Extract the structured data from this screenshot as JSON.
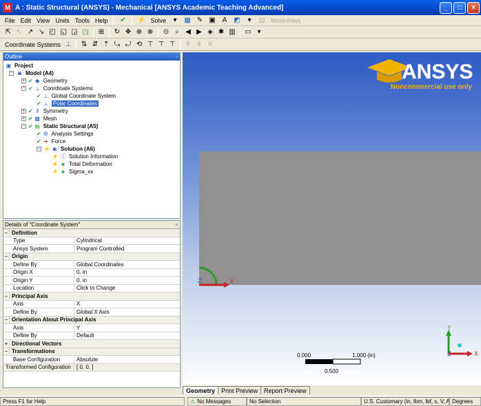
{
  "window": {
    "title": "A : Static Structural (ANSYS) - Mechanical [ANSYS Academic Teaching Advanced]",
    "app_icon": "ansys-mechanical-icon"
  },
  "menu": [
    "File",
    "Edit",
    "View",
    "Units",
    "Tools",
    "Help"
  ],
  "toolbar": {
    "solve_label": "Solve",
    "worksheet_label": "Worksheet"
  },
  "context_toolbar": {
    "label": "Coordinate Systems"
  },
  "outline": {
    "title": "Outline",
    "nodes": [
      {
        "label": "Project",
        "bold": true
      },
      {
        "label": "Model (A4)",
        "bold": true
      },
      {
        "label": "Geometry"
      },
      {
        "label": "Coordinate Systems"
      },
      {
        "label": "Global Coordinate System"
      },
      {
        "label": "Polar Coordinates"
      },
      {
        "label": "Symmetry"
      },
      {
        "label": "Mesh"
      },
      {
        "label": "Static Structural (A5)",
        "bold": true
      },
      {
        "label": "Analysis Settings"
      },
      {
        "label": "Force"
      },
      {
        "label": "Solution (A6)",
        "bold": true
      },
      {
        "label": "Solution Information"
      },
      {
        "label": "Total Deformation"
      },
      {
        "label": "Sigma_xx"
      }
    ]
  },
  "details": {
    "title": "Details of \"Coordinate System\"",
    "groups": [
      {
        "name": "Definition",
        "rows": [
          [
            "Type",
            "Cylindrical"
          ],
          [
            "Ansys System",
            "Program Controlled"
          ]
        ]
      },
      {
        "name": "Origin",
        "rows": [
          [
            "Define By",
            "Global Coordinates"
          ],
          [
            "Origin X",
            "0. in"
          ],
          [
            "Origin Y",
            "0. in"
          ],
          [
            "Location",
            "Click to Change"
          ]
        ]
      },
      {
        "name": "Principal Axis",
        "rows": [
          [
            "Axis",
            "X"
          ],
          [
            "Define By",
            "Global X Axis"
          ]
        ]
      },
      {
        "name": "Orientation About Principal Axis",
        "rows": [
          [
            "Axis",
            "Y"
          ],
          [
            "Define By",
            "Default"
          ]
        ]
      },
      {
        "name": "Directional Vectors",
        "rows": []
      },
      {
        "name": "Transformations",
        "rows": [
          [
            "Base Configuration",
            "Absolute"
          ],
          [
            "Transformed Configuration",
            "[ 0. 0. ]"
          ]
        ]
      }
    ]
  },
  "viewport": {
    "logo_text": "ANSYS",
    "logo_sub": "Noncommercial use only",
    "scale": {
      "left": "0.000",
      "right": "1.000 (in)",
      "mid": "0.500"
    },
    "triad": {
      "x": "X",
      "y": "Y",
      "z": "Z"
    }
  },
  "tabs": [
    "Geometry",
    "Print Preview",
    "Report Preview"
  ],
  "status": {
    "help": "Press F1 for Help",
    "messages": "No Messages",
    "selection": "No Selection",
    "units": "U.S. Customary (in, lbm, lbf, s, V, A)",
    "angle": "Degrees"
  },
  "colors": {
    "title_bar": "#0a5ee8",
    "selection": "#3169c6",
    "viewport_top": "#2e5ac4",
    "logo_gold": "#f0b400"
  }
}
